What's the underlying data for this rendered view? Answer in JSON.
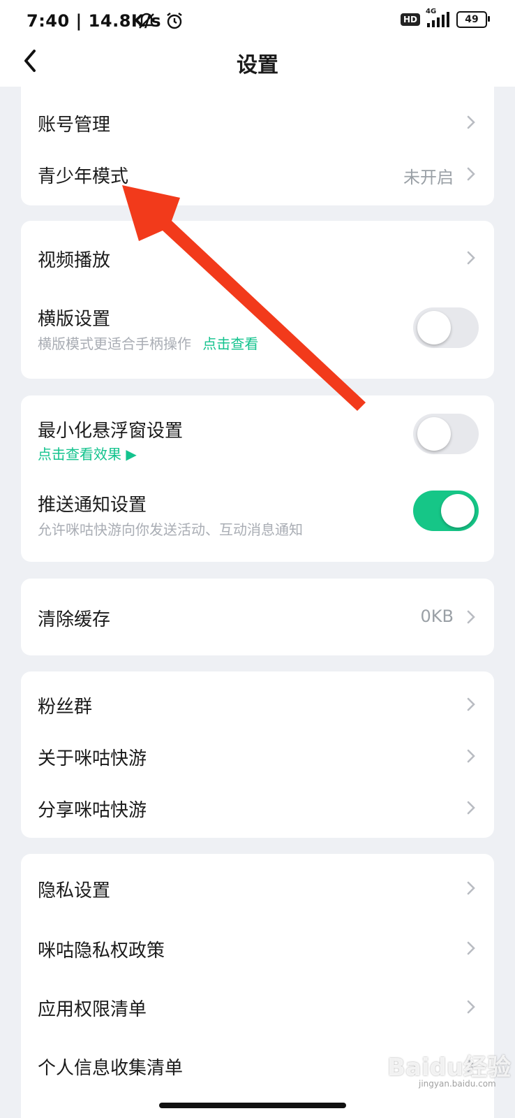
{
  "status_bar": {
    "time_speed": "7:40 | 14.8K/s",
    "hd": "HD",
    "network": "4G",
    "battery": "49"
  },
  "header": {
    "title": "设置"
  },
  "sections": {
    "account": {
      "account_management": "账号管理",
      "teen_mode": "青少年模式",
      "teen_mode_value": "未开启"
    },
    "video": {
      "video_playback": "视频播放",
      "landscape": "横版设置",
      "landscape_sub": "横版模式更适合手柄操作",
      "landscape_link": "点击查看",
      "landscape_on": false
    },
    "notify": {
      "float_window": "最小化悬浮窗设置",
      "float_link": "点击查看效果 ▶",
      "float_on": false,
      "push": "推送通知设置",
      "push_sub": "允许咪咕快游向你发送活动、互动消息通知",
      "push_on": true
    },
    "cache": {
      "clear_cache": "清除缓存",
      "cache_value": "0KB"
    },
    "about": {
      "fans_group": "粉丝群",
      "about_app": "关于咪咕快游",
      "share_app": "分享咪咕快游"
    },
    "privacy": {
      "privacy_settings": "隐私设置",
      "privacy_policy": "咪咕隐私权政策",
      "permissions_list": "应用权限清单",
      "info_collection": "个人信息收集清单"
    }
  },
  "watermark": {
    "logo": "Baidu经验",
    "url": "jingyan.baidu.com"
  },
  "colors": {
    "accent_green": "#16c687",
    "arrow_red": "#f23a1b",
    "background": "#eef0f4"
  }
}
